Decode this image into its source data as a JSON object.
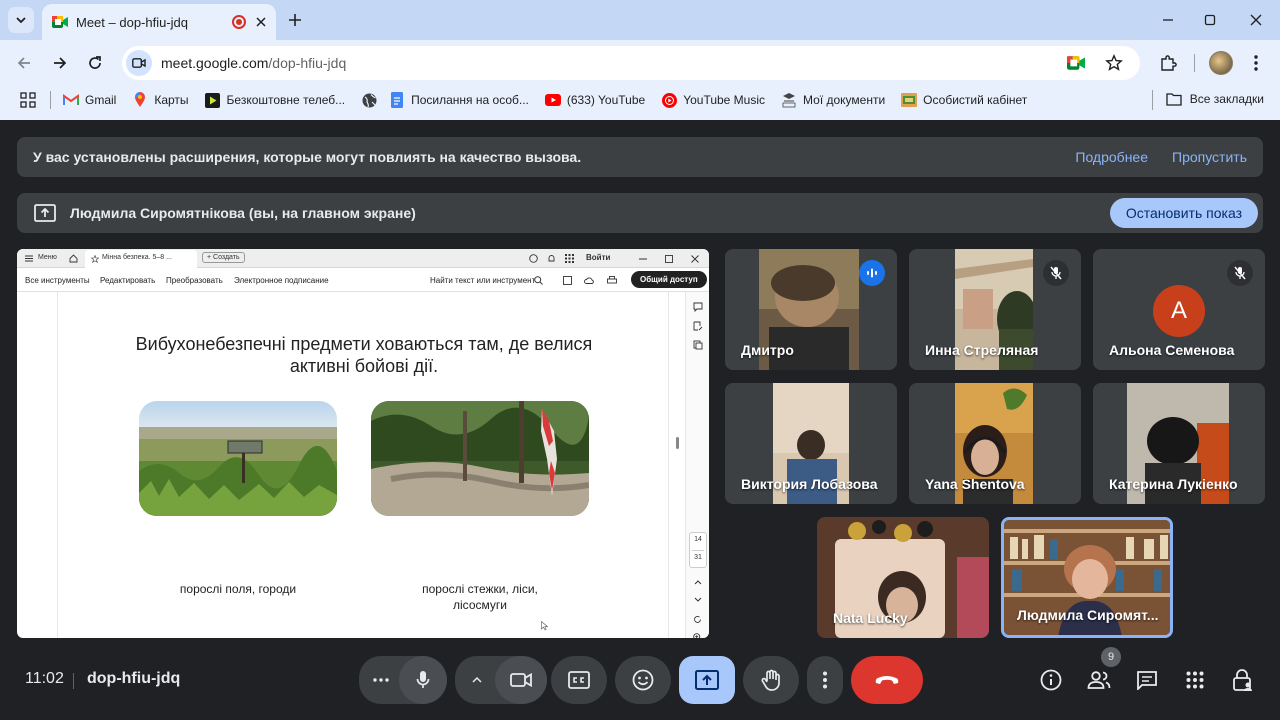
{
  "browser": {
    "tab_title": "Meet – dop-hfiu-jdq",
    "url_host": "meet.google.com",
    "url_path": "/dop-hfiu-jdq",
    "bookmarks": [
      {
        "label": "Gmail",
        "icon": "gmail-icon"
      },
      {
        "label": "Карты",
        "icon": "maps-icon"
      },
      {
        "label": "Безкоштовне телеб...",
        "icon": "play-icon"
      },
      {
        "label": "",
        "icon": "globe-icon"
      },
      {
        "label": "Посилання на особ...",
        "icon": "docs-icon"
      },
      {
        "label": "(633) YouTube",
        "icon": "youtube-icon"
      },
      {
        "label": "YouTube Music",
        "icon": "youtube-music-icon"
      },
      {
        "label": "Мої документи",
        "icon": "documents-icon"
      },
      {
        "label": "Особистий кабінет",
        "icon": "cabinet-icon"
      }
    ],
    "all_bookmarks": "Все закладки"
  },
  "meet": {
    "extension_banner": {
      "message": "У вас установлены расширения, которые могут повлиять на качество вызова.",
      "more_link": "Подробнее",
      "skip_link": "Пропустить"
    },
    "presentation_banner": {
      "message": "Людмила Сиромятнікова (вы, на главном экране)",
      "stop_button": "Остановить показ"
    },
    "shared_screen": {
      "tabs": {
        "menu": "Меню",
        "doc_tab": "Мінна безпека. 5–8 ...",
        "create": "+ Создать",
        "login": "Войти"
      },
      "tools": {
        "all_tools": "Все инструменты",
        "edit": "Редактировать",
        "convert": "Преобразовать",
        "esign": "Электронное подписание",
        "search": "Найти текст или инструмент",
        "share": "Общий доступ"
      },
      "slide_title_line1": "Вибухонебезпечні предмети ховаються там, де велися",
      "slide_title_line2": "активні бойові дії.",
      "caption_left": "порослі поля, городи",
      "caption_right_line1": "порослі стежки, ліси,",
      "caption_right_line2": "лісосмуги",
      "page_current": "14",
      "page_total": "31"
    },
    "participants": [
      {
        "name": "Дмитро",
        "state": "speaking"
      },
      {
        "name": "Инна Стреляная",
        "state": "muted"
      },
      {
        "name": "Альона Семенова",
        "state": "muted",
        "initial": "A"
      },
      {
        "name": "Виктория Лобазова",
        "state": "video"
      },
      {
        "name": "Yana Shentova",
        "state": "video"
      },
      {
        "name": "Катерина Лукіенко",
        "state": "video"
      },
      {
        "name": "Nata Lucky",
        "state": "video"
      },
      {
        "name": "Людмила Сиромят...",
        "state": "self"
      }
    ],
    "clock": "11:02",
    "meeting_code": "dop-hfiu-jdq",
    "people_count": "9"
  }
}
